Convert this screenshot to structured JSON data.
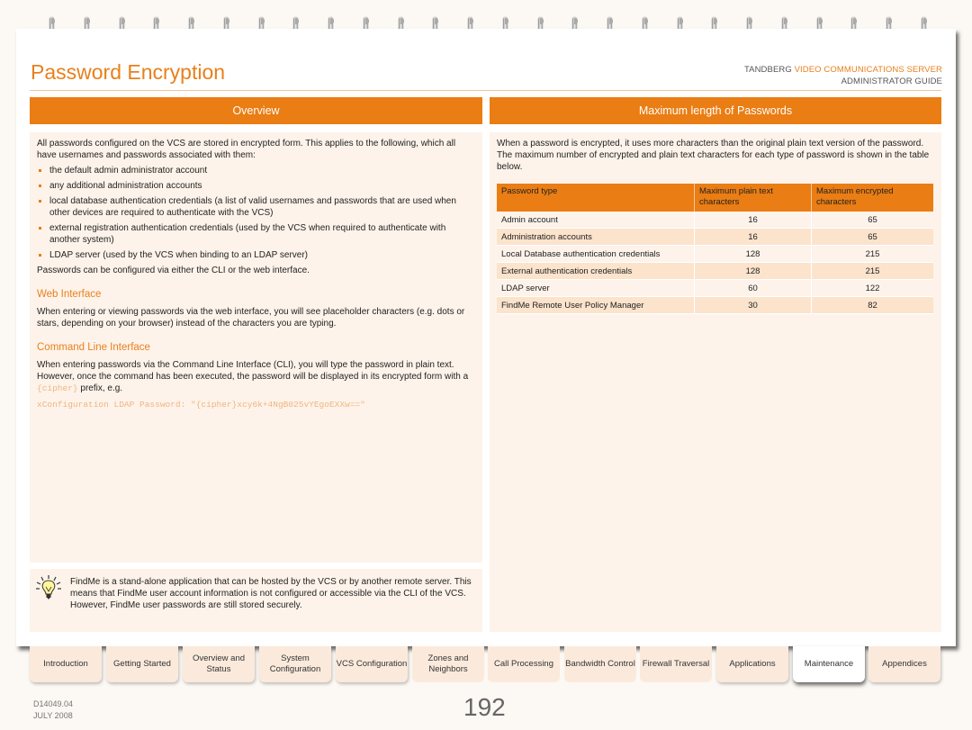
{
  "page": {
    "title": "Password Encryption",
    "brand_prefix": "TANDBERG",
    "brand_accent": "VIDEO COMMUNICATIONS SERVER",
    "brand_sub": "ADMINISTRATOR GUIDE",
    "accent_color": "#ea7d13"
  },
  "left": {
    "header": "Overview",
    "intro": "All passwords configured on the VCS are stored in encrypted form.  This applies to the following, which all have usernames and passwords associated with them:",
    "bullets": [
      "the default admin administrator account",
      "any additional administration accounts",
      "local database authentication credentials (a list of valid usernames and passwords that are used when other devices are required to authenticate with the VCS)",
      "external registration authentication credentials (used by the VCS when required to authenticate with another system)",
      "LDAP server (used by the VCS when binding to an LDAP server)"
    ],
    "outro": "Passwords can be configured via either the CLI or the web interface.",
    "web_heading": "Web Interface",
    "web_text": "When entering or viewing passwords via the web interface, you will see placeholder characters (e.g. dots or stars, depending on your browser) instead of the characters you are typing.",
    "cli_heading": "Command Line Interface",
    "cli_text_before": "When entering passwords via the Command Line Interface (CLI), you will type the password in plain text.  However, once the command has been executed, the password will be displayed in its encrypted form with a ",
    "cli_inline_code": "{cipher}",
    "cli_text_after": " prefix, e.g.",
    "cli_example": "xConfiguration LDAP Password: \"{cipher}xcy6k+4NgB025vYEgoEXXw==\""
  },
  "tip": {
    "icon": "lightbulb-icon",
    "text": "FindMe is a stand-alone application that can be hosted by the VCS or by another remote server.  This means that FindMe user account information is not configured or accessible via the CLI of the VCS.  However, FindMe user passwords are still stored securely."
  },
  "right": {
    "header": "Maximum length of Passwords",
    "intro": "When a password is encrypted, it uses more characters than the original plain text version of the password.  The maximum number of encrypted and plain text characters for each type of password is shown in the table below.",
    "table": {
      "columns": [
        "Password type",
        "Maximum plain text characters",
        "Maximum encrypted characters"
      ],
      "rows": [
        [
          "Admin account",
          "16",
          "65"
        ],
        [
          "Administration accounts",
          "16",
          "65"
        ],
        [
          "Local Database authentication credentials",
          "128",
          "215"
        ],
        [
          "External authentication credentials",
          "128",
          "215"
        ],
        [
          "LDAP server",
          "60",
          "122"
        ],
        [
          "FindMe Remote User Policy Manager",
          "30",
          "82"
        ]
      ]
    }
  },
  "tabs": [
    {
      "label": "Introduction",
      "active": false
    },
    {
      "label": "Getting Started",
      "active": false
    },
    {
      "label": "Overview and Status",
      "active": false
    },
    {
      "label": "System Configuration",
      "active": false
    },
    {
      "label": "VCS Configuration",
      "active": false
    },
    {
      "label": "Zones and Neighbors",
      "active": false
    },
    {
      "label": "Call Processing",
      "active": false
    },
    {
      "label": "Bandwidth Control",
      "active": false
    },
    {
      "label": "Firewall Traversal",
      "active": false
    },
    {
      "label": "Applications",
      "active": false
    },
    {
      "label": "Maintenance",
      "active": true
    },
    {
      "label": "Appendices",
      "active": false
    }
  ],
  "footer": {
    "doc_id": "D14049.04",
    "date": "JULY 2008",
    "page_number": "192"
  }
}
